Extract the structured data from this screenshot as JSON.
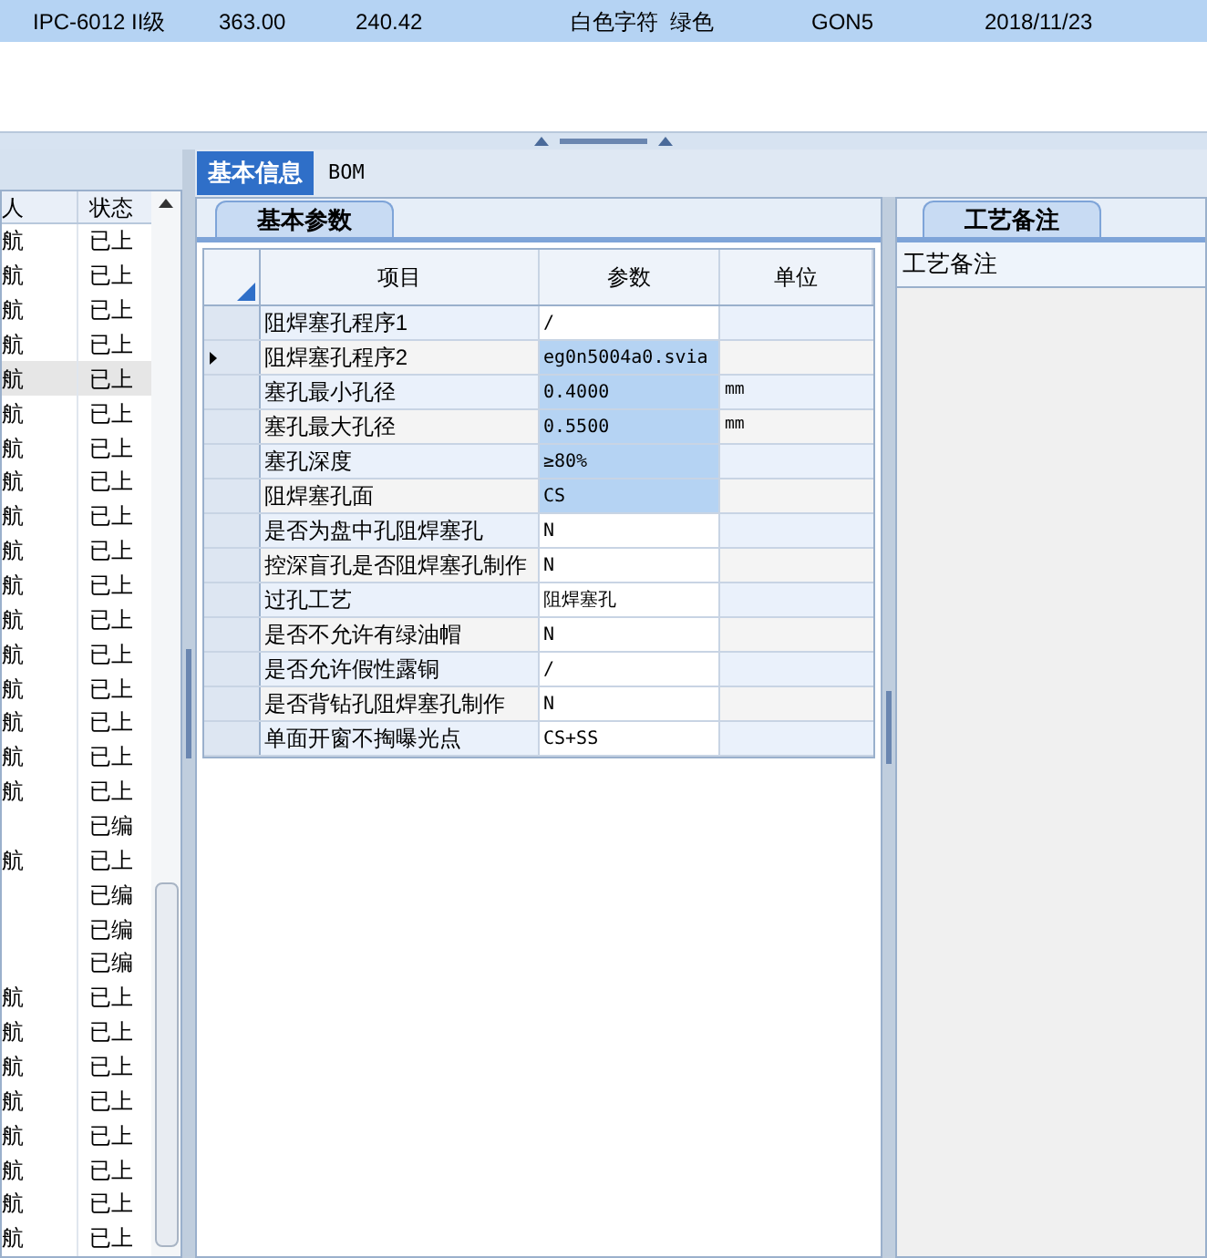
{
  "top_row": {
    "selected": true,
    "cells": [
      "IPC-6012 II级",
      "363.00",
      "240.42",
      "白色字符  绿色",
      "GON5",
      "2018/11/23"
    ]
  },
  "left_list": {
    "columns": [
      "人",
      "状态"
    ],
    "rows": [
      {
        "person": "航",
        "status": "已上",
        "selected": false
      },
      {
        "person": "航",
        "status": "已上",
        "selected": false
      },
      {
        "person": "航",
        "status": "已上",
        "selected": false
      },
      {
        "person": "航",
        "status": "已上",
        "selected": false
      },
      {
        "person": "航",
        "status": "已上",
        "selected": true
      },
      {
        "person": "航",
        "status": "已上",
        "selected": false
      },
      {
        "person": "航",
        "status": "已上",
        "selected": false
      },
      {
        "person": "航",
        "status": "已上",
        "selected": false
      },
      {
        "person": "航",
        "status": "已上",
        "selected": false
      },
      {
        "person": "航",
        "status": "已上",
        "selected": false
      },
      {
        "person": "航",
        "status": "已上",
        "selected": false
      },
      {
        "person": "航",
        "status": "已上",
        "selected": false
      },
      {
        "person": "航",
        "status": "已上",
        "selected": false
      },
      {
        "person": "航",
        "status": "已上",
        "selected": false
      },
      {
        "person": "航",
        "status": "已上",
        "selected": false
      },
      {
        "person": "航",
        "status": "已上",
        "selected": false
      },
      {
        "person": "航",
        "status": "已上",
        "selected": false
      },
      {
        "status": "已编",
        "selected": false
      },
      {
        "person": "航",
        "status": "已上",
        "selected": false
      },
      {
        "status": "已编",
        "selected": false
      },
      {
        "status": "已编",
        "selected": false
      },
      {
        "status": "已编",
        "selected": false
      },
      {
        "person": "航",
        "status": "已上",
        "selected": false
      },
      {
        "person": "航",
        "status": "已上",
        "selected": false
      },
      {
        "person": "航",
        "status": "已上",
        "selected": false
      },
      {
        "person": "航",
        "status": "已上",
        "selected": false
      },
      {
        "person": "航",
        "status": "已上",
        "selected": false
      },
      {
        "person": "航",
        "status": "已上",
        "selected": false
      },
      {
        "person": "航",
        "status": "已上",
        "selected": false
      },
      {
        "person": "航",
        "status": "已上",
        "selected": false
      }
    ]
  },
  "tabs": [
    {
      "label": "基本信息",
      "selected": true
    },
    {
      "label": "BOM",
      "selected": false
    }
  ],
  "param_panel": {
    "tab": "基本参数",
    "columns": [
      "项目",
      "参数",
      "单位"
    ],
    "rows": [
      {
        "item": "阻焊塞孔程序1",
        "value": "/",
        "selected": false,
        "current": false
      },
      {
        "item": "阻焊塞孔程序2",
        "value": "eg0n5004a0.svia",
        "selected": true,
        "current": true
      },
      {
        "item": "塞孔最小孔径",
        "value": "0.4000",
        "unit": "mm",
        "selected": true,
        "current": false
      },
      {
        "item": "塞孔最大孔径",
        "value": "0.5500",
        "unit": "mm",
        "selected": true,
        "current": false
      },
      {
        "item": "塞孔深度",
        "value": "≥80%",
        "selected": true,
        "current": false
      },
      {
        "item": "阻焊塞孔面",
        "value": "CS",
        "selected": true,
        "current": false
      },
      {
        "item": "是否为盘中孔阻焊塞孔",
        "value": "N",
        "selected": false,
        "current": false
      },
      {
        "item": "控深盲孔是否阻焊塞孔制作",
        "value": "N",
        "selected": false,
        "current": false
      },
      {
        "item": "过孔工艺",
        "value": "阻焊塞孔",
        "selected": false,
        "current": false
      },
      {
        "item": "是否不允许有绿油帽",
        "value": "N",
        "selected": false,
        "current": false
      },
      {
        "item": "是否允许假性露铜",
        "value": "/",
        "selected": false,
        "current": false
      },
      {
        "item": "是否背钻孔阻焊塞孔制作",
        "value": "N",
        "selected": false,
        "current": false
      },
      {
        "item": "单面开窗不掏曝光点",
        "value": "CS+SS",
        "selected": false,
        "current": false
      }
    ]
  },
  "notes_panel": {
    "tab": "工艺备注",
    "header": "工艺备注"
  }
}
